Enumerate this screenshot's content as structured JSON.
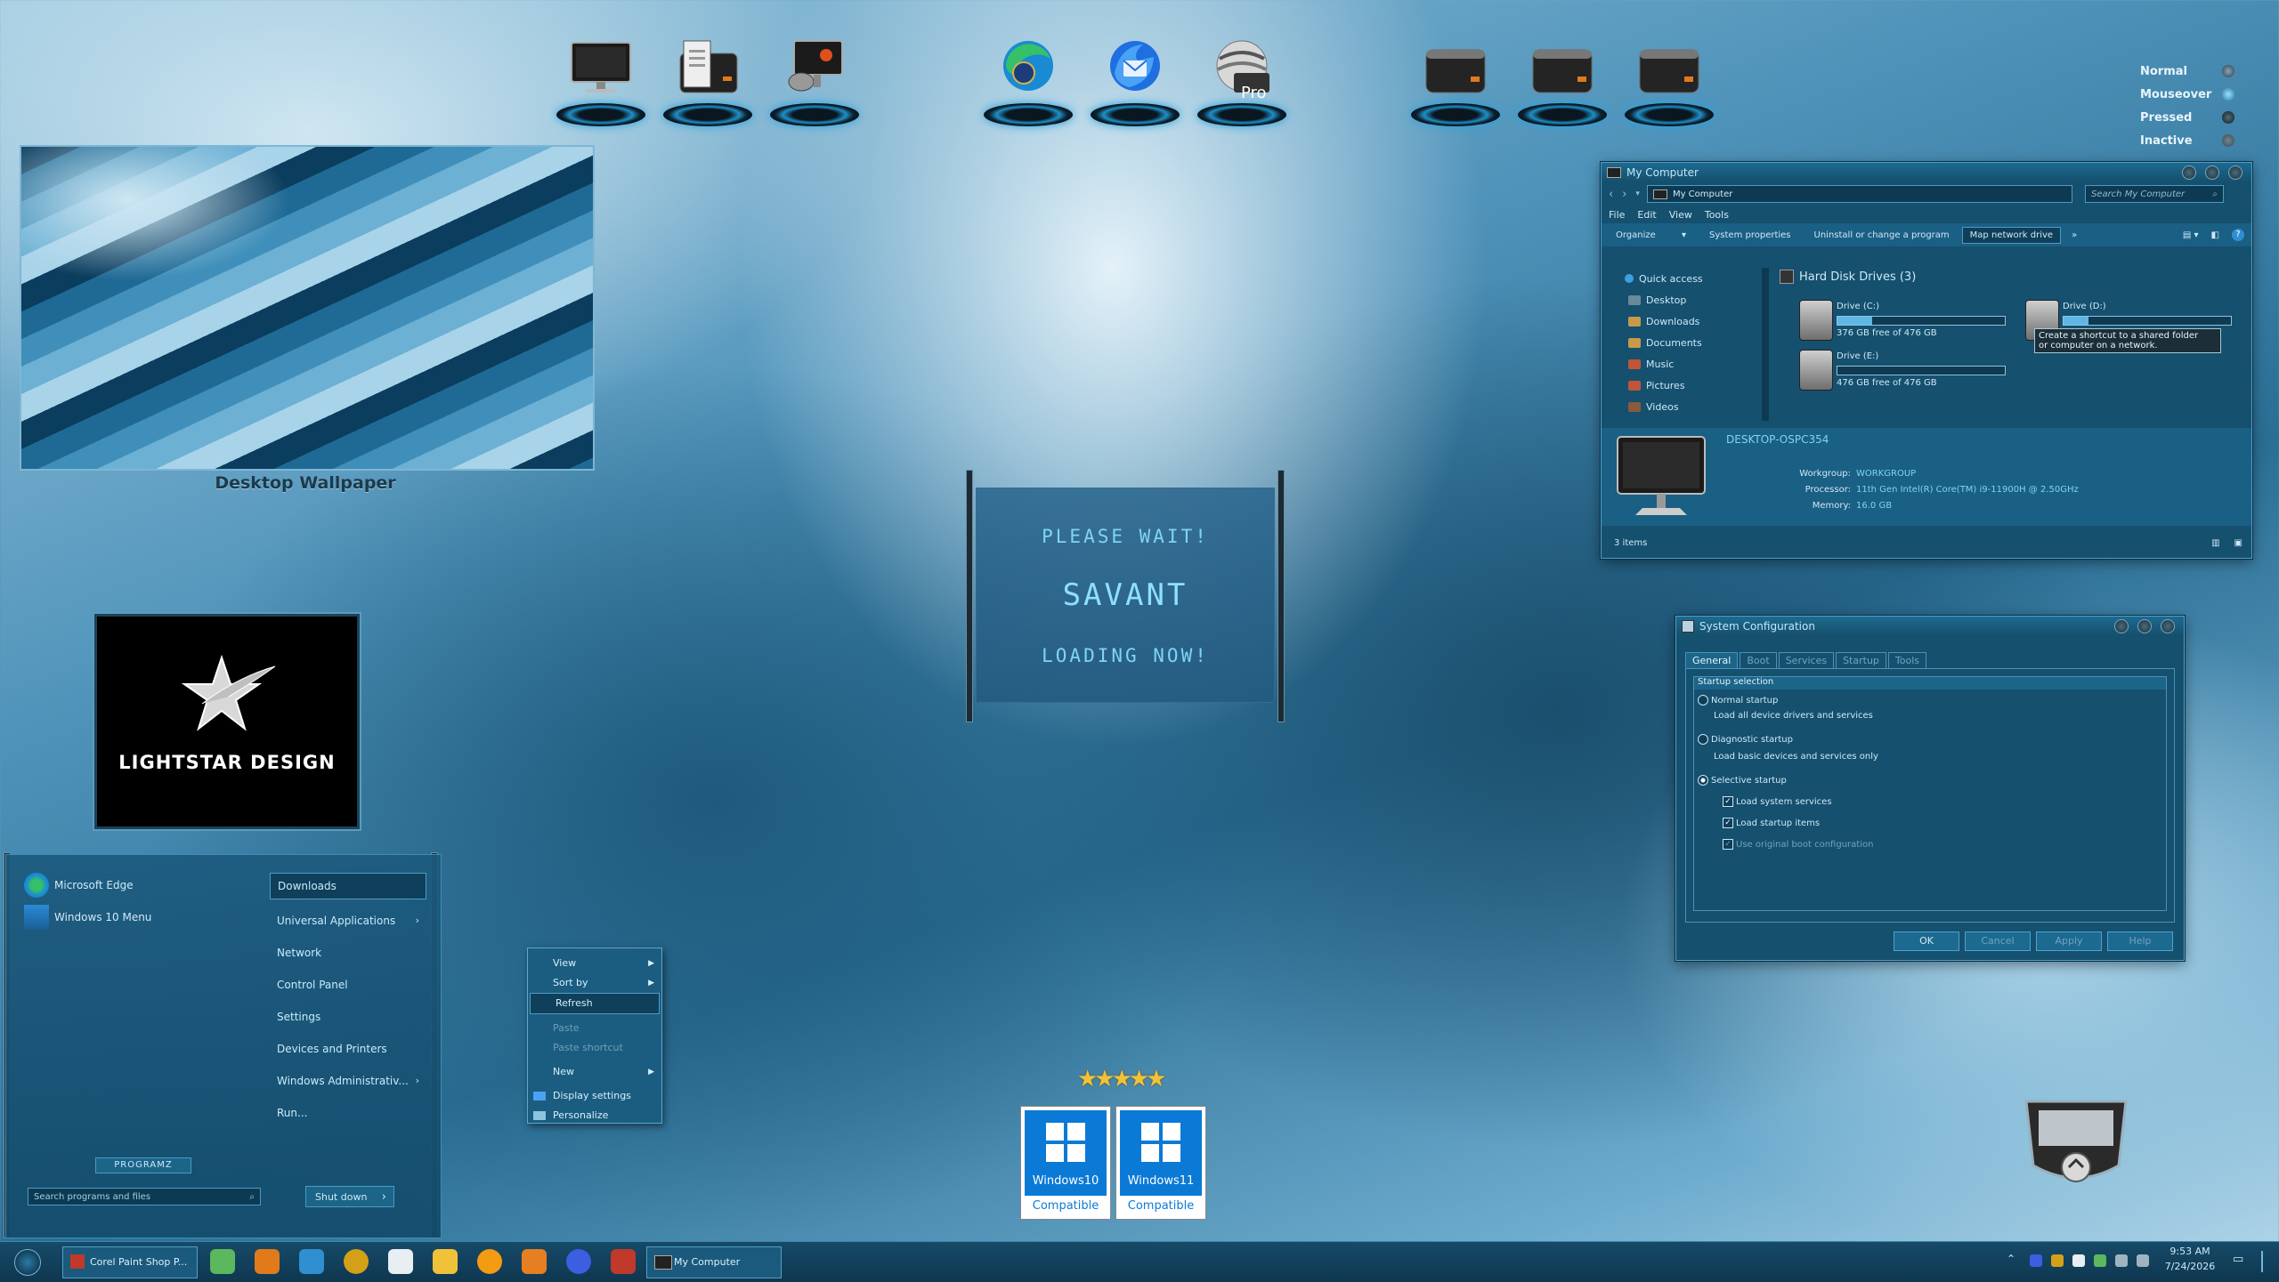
{
  "wallpaper": {
    "caption": "Desktop Wallpaper"
  },
  "branding": {
    "logo_text": "LIGHTSTAR DESIGN"
  },
  "top_dock": {
    "icons": [
      "monitor-icon",
      "clipboard-drive-icon",
      "satellite-monitor-icon",
      "edge-icon",
      "thunderbird-icon",
      "google-earth-pro-icon",
      "drive-icon-1",
      "drive-icon-2",
      "drive-icon-3"
    ],
    "earth_badge": "Pro"
  },
  "button_states": {
    "normal": "Normal",
    "mouseover": "Mouseover",
    "pressed": "Pressed",
    "inactive": "Inactive"
  },
  "splash": {
    "line1": "PLEASE WAIT!",
    "line2": "SAVANT",
    "line3": "LOADING NOW!"
  },
  "my_computer": {
    "title": "My Computer",
    "address": "My Computer",
    "search_placeholder": "Search My Computer",
    "menu": [
      "File",
      "Edit",
      "View",
      "Tools"
    ],
    "commands": [
      "Organize",
      "System properties",
      "Uninstall or change a program",
      "Map network drive",
      "»"
    ],
    "nav": [
      "Quick access",
      "Desktop",
      "Downloads",
      "Documents",
      "Music",
      "Pictures",
      "Videos"
    ],
    "section_title": "Hard Disk Drives (3)",
    "drives": [
      {
        "name": "Drive (C:)",
        "free": "376 GB free of 476 GB",
        "used_fraction": 0.21
      },
      {
        "name": "Drive (E:)",
        "free": "476 GB free of 476 GB",
        "used_fraction": 0.0
      },
      {
        "name": "Drive (D:)",
        "free": "",
        "used_fraction": 0.15
      }
    ],
    "tooltip_line1": "Create a shortcut to a shared folder",
    "tooltip_line2": "or computer on a network.",
    "details": {
      "computer_name": "DESKTOP-OSPC354",
      "workgroup_label": "Workgroup:",
      "workgroup": "WORKGROUP",
      "processor_label": "Processor:",
      "processor": "11th Gen Intel(R) Core(TM) i9-11900H @ 2.50GHz",
      "memory_label": "Memory:",
      "memory": "16.0 GB"
    },
    "status": "3 items"
  },
  "sysconfig": {
    "title": "System Configuration",
    "tabs": [
      "General",
      "Boot",
      "Services",
      "Startup",
      "Tools"
    ],
    "group": "Startup selection",
    "normal": "Normal startup",
    "normal_desc": "Load all device drivers and services",
    "diagnostic": "Diagnostic startup",
    "diagnostic_desc": "Load basic devices and services only",
    "selective": "Selective startup",
    "load_services": "Load system services",
    "load_startup": "Load startup items",
    "use_original": "Use original boot configuration",
    "buttons": [
      "OK",
      "Cancel",
      "Apply",
      "Help"
    ]
  },
  "start_menu": {
    "pinned": [
      "Microsoft Edge",
      "Windows 10 Menu"
    ],
    "right": [
      "Downloads",
      "Universal Applications",
      "Network",
      "Control Panel",
      "Settings",
      "Devices and Printers",
      "Windows Administrativ...",
      "Run..."
    ],
    "programs_label": "PROGRAMZ",
    "search_placeholder": "Search programs and files",
    "shutdown": "Shut down"
  },
  "context_menu": {
    "items": [
      "View",
      "Sort by",
      "Refresh",
      "Paste",
      "Paste shortcut",
      "New",
      "Display settings",
      "Personalize"
    ]
  },
  "compat": {
    "win10_name": "Windows10",
    "win10_label": "Compatible",
    "win11_name": "Windows11",
    "win11_label": "Compatible",
    "stars": 5
  },
  "taskbar": {
    "task1": "Corel Paint Shop P...",
    "task2": "My Computer",
    "time": "9:53 AM",
    "date": "7/24/2026"
  }
}
